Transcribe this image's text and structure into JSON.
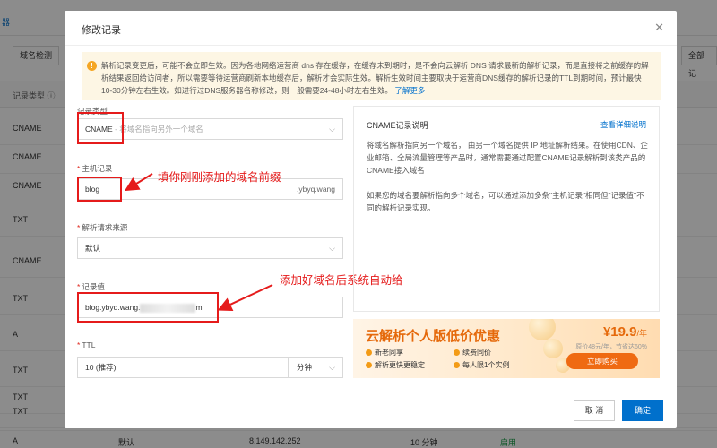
{
  "background": {
    "top_label": "器",
    "toolbar": {
      "domain_check": "域名检测",
      "all_records": "全部记"
    },
    "header": "记录类型",
    "rows": [
      "CNAME",
      "CNAME",
      "CNAME",
      "TXT",
      "CNAME",
      "TXT",
      "A",
      "TXT",
      "TXT",
      "TXT"
    ],
    "bottom_row": {
      "type": "A",
      "line": "默认",
      "value": "8.149.142.252",
      "ttl": "10 分钟",
      "status": "启用"
    }
  },
  "modal": {
    "title": "修改记录",
    "close": "✕",
    "notice": {
      "icon": "!",
      "text": "解析记录变更后，可能不会立即生效。因为各地网络运营商 dns 存在缓存，在缓存未到期时，是不会向云解析 DNS 请求最新的解析记录，而是直接将之前缓存的解析结果返回给访问者，所以需要等待运营商刷新本地缓存后，解析才会实际生效。解析生效时间主要取决于运营商DNS缓存的解析记录的TTL到期时间，预计最快10-30分钟左右生效。如进行过DNS服务器名称修改，则一般需要24-48小时左右生效。",
      "link": "了解更多"
    },
    "record_type": {
      "label": "记录类型",
      "value": "CNAME",
      "hint": "- 将域名指向另外一个域名"
    },
    "host": {
      "label": "主机记录",
      "value": "blog",
      "suffix": ".ybyq.wang"
    },
    "line": {
      "label": "解析请求来源",
      "value": "默认"
    },
    "record_value": {
      "label": "记录值",
      "prefix": "blog.ybyq.wang.",
      "end": "m"
    },
    "ttl": {
      "label": "TTL",
      "value": "10 (推荐)",
      "unit": "分钟"
    },
    "cancel": "取 消",
    "ok": "确定"
  },
  "annotations": {
    "host": "填你刚刚添加的域名前缀",
    "value": "添加好域名后系统自动给"
  },
  "info": {
    "title": "CNAME记录说明",
    "link": "查看详细说明",
    "p1": "将域名解析指向另一个域名， 由另一个域名提供 IP 地址解析结果。在使用CDN、企业邮箱、全局流量管理等产品时，通常需要通过配置CNAME记录解析到该类产品的CNAME接入域名",
    "p2": "如果您的域名要解析指向多个域名，可以通过添加多条\"主机记录\"相同但\"记录值\"不同的解析记录实现。"
  },
  "promo": {
    "title": "云解析个人版低价优惠",
    "features": [
      "新老同享",
      "续费同价",
      "解析更快更稳定",
      "每人限1个实例"
    ],
    "price": "¥19.9",
    "unit": "/年",
    "original": "原价48元/年，节省达60%",
    "buy": "立即购买"
  },
  "colors": {
    "primary": "#0070cc",
    "annotation": "#e51b1b",
    "promo": "#e5690b"
  }
}
